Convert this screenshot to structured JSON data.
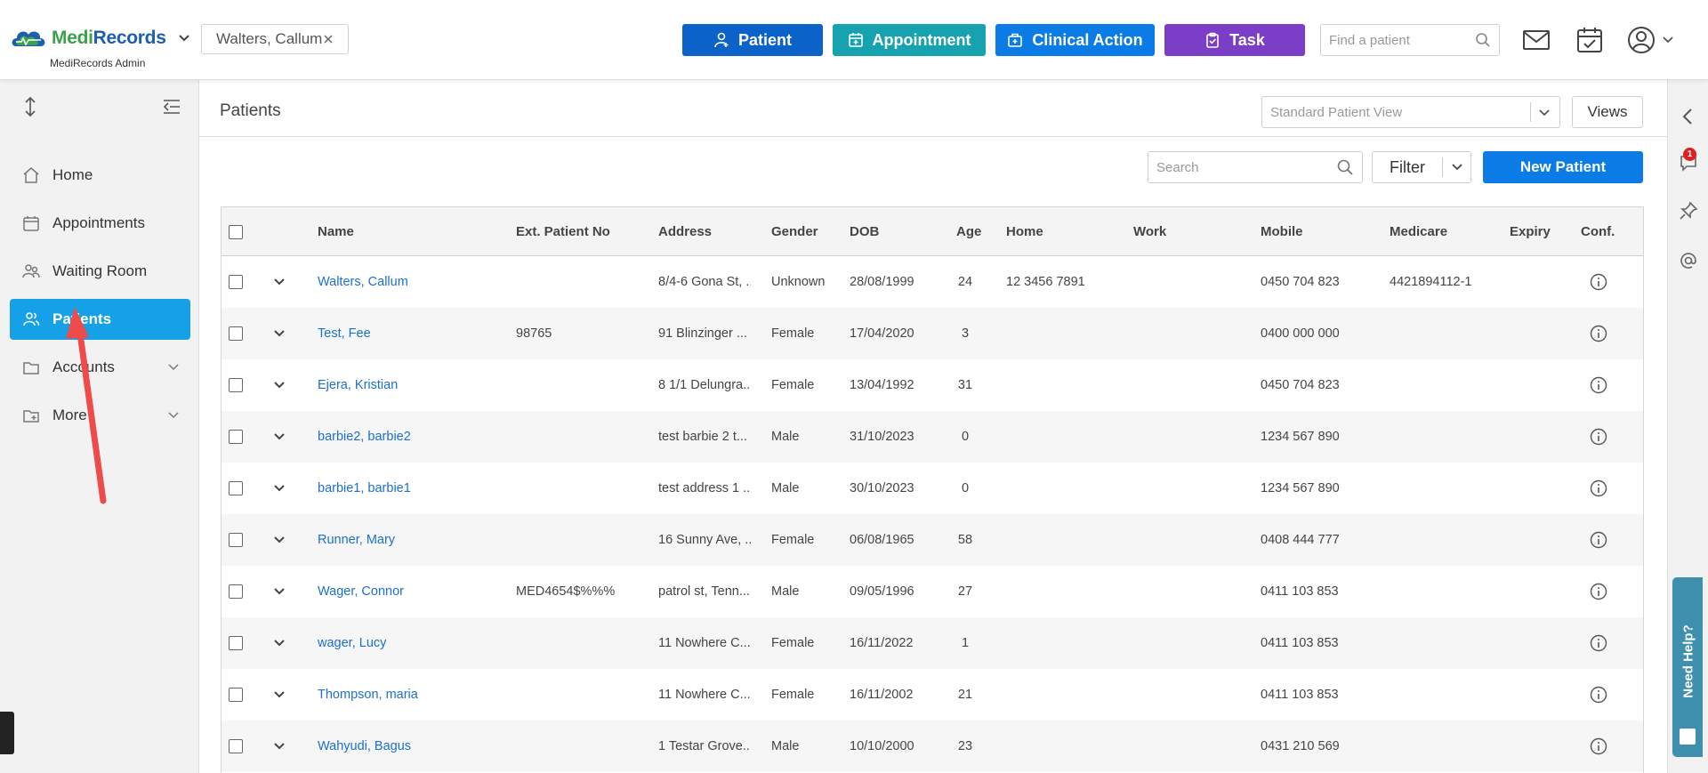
{
  "app": {
    "brand_part1": "Medi",
    "brand_part2": "Records",
    "brand_subtitle": "MediRecords Admin"
  },
  "open_patient_tab": "Walters, Callum",
  "actions": {
    "patient": "Patient",
    "appointment": "Appointment",
    "clinical_action": "Clinical Action",
    "task": "Task"
  },
  "find_patient_placeholder": "Find a patient",
  "sidebar": {
    "items": [
      {
        "label": "Home"
      },
      {
        "label": "Appointments"
      },
      {
        "label": "Waiting Room"
      },
      {
        "label": "Patients"
      },
      {
        "label": "Accounts"
      },
      {
        "label": "More"
      }
    ]
  },
  "page": {
    "title": "Patients",
    "view_select_value": "Standard Patient View",
    "views_label": "Views",
    "search_placeholder": "Search",
    "filter_label": "Filter",
    "new_patient_label": "New Patient"
  },
  "table": {
    "columns": {
      "name": "Name",
      "ext_no": "Ext. Patient No",
      "address": "Address",
      "gender": "Gender",
      "dob": "DOB",
      "age": "Age",
      "home": "Home",
      "work": "Work",
      "mobile": "Mobile",
      "medicare": "Medicare",
      "expiry": "Expiry",
      "conf": "Conf."
    },
    "rows": [
      {
        "name": "Walters, Callum",
        "ext_no": "",
        "address": "8/4-6 Gona St, ...",
        "gender": "Unknown",
        "dob": "28/08/1999",
        "age": "24",
        "home": "12 3456 7891",
        "work": "",
        "mobile": "0450 704 823",
        "medicare": "4421894112-1",
        "expiry": ""
      },
      {
        "name": "Test, Fee",
        "ext_no": "98765",
        "address": "91 Blinzinger ...",
        "gender": "Female",
        "dob": "17/04/2020",
        "age": "3",
        "home": "",
        "work": "",
        "mobile": "0400 000 000",
        "medicare": "",
        "expiry": ""
      },
      {
        "name": "Ejera, Kristian",
        "ext_no": "",
        "address": "8 1/1 Delungra...",
        "gender": "Female",
        "dob": "13/04/1992",
        "age": "31",
        "home": "",
        "work": "",
        "mobile": "0450 704 823",
        "medicare": "",
        "expiry": ""
      },
      {
        "name": "barbie2, barbie2",
        "ext_no": "",
        "address": "test barbie 2 t...",
        "gender": "Male",
        "dob": "31/10/2023",
        "age": "0",
        "home": "",
        "work": "",
        "mobile": "1234 567 890",
        "medicare": "",
        "expiry": ""
      },
      {
        "name": "barbie1, barbie1",
        "ext_no": "",
        "address": "test address 1 ...",
        "gender": "Male",
        "dob": "30/10/2023",
        "age": "0",
        "home": "",
        "work": "",
        "mobile": "1234 567 890",
        "medicare": "",
        "expiry": ""
      },
      {
        "name": "Runner, Mary",
        "ext_no": "",
        "address": "16 Sunny Ave, ...",
        "gender": "Female",
        "dob": "06/08/1965",
        "age": "58",
        "home": "",
        "work": "",
        "mobile": "0408 444 777",
        "medicare": "",
        "expiry": ""
      },
      {
        "name": "Wager, Connor",
        "ext_no": "MED4654$%%%",
        "address": "patrol st, Tenn...",
        "gender": "Male",
        "dob": "09/05/1996",
        "age": "27",
        "home": "",
        "work": "",
        "mobile": "0411 103 853",
        "medicare": "",
        "expiry": ""
      },
      {
        "name": "wager, Lucy",
        "ext_no": "",
        "address": "11 Nowhere C...",
        "gender": "Female",
        "dob": "16/11/2022",
        "age": "1",
        "home": "",
        "work": "",
        "mobile": "0411 103 853",
        "medicare": "",
        "expiry": ""
      },
      {
        "name": "Thompson, maria",
        "ext_no": "",
        "address": "11 Nowhere C...",
        "gender": "Female",
        "dob": "16/11/2002",
        "age": "21",
        "home": "",
        "work": "",
        "mobile": "0411 103 853",
        "medicare": "",
        "expiry": ""
      },
      {
        "name": "Wahyudi, Bagus",
        "ext_no": "",
        "address": "1 Testar Grove...",
        "gender": "Male",
        "dob": "10/10/2000",
        "age": "23",
        "home": "",
        "work": "",
        "mobile": "0431 210 569",
        "medicare": "",
        "expiry": ""
      }
    ]
  },
  "rail": {
    "notification_count": "1"
  },
  "help_label": "Need Help?",
  "colors": {
    "active_nav": "#15a0e8",
    "patient_btn": "#0b62c9",
    "appointment_btn": "#17a2b0",
    "clinical_btn": "#0b7ce6",
    "task_btn": "#7a3fc6",
    "link": "#1a6fd0",
    "annotation_arrow": "#ee4b4b"
  },
  "icons": {
    "topbar": [
      "logo-icon",
      "chevron-down-icon",
      "close-icon",
      "user-plus-icon",
      "calendar-plus-icon",
      "medical-bag-icon",
      "clipboard-check-icon",
      "search-icon",
      "mail-icon",
      "calendar-check-icon",
      "user-circle-icon"
    ],
    "sidebar": [
      "resize-vertical-icon",
      "collapse-menu-icon",
      "home-icon",
      "calendar-icon",
      "people-icon",
      "patients-icon",
      "folder-icon",
      "folder-plus-icon"
    ],
    "rail": [
      "chevron-left-icon",
      "chat-icon",
      "pin-icon",
      "at-icon"
    ]
  }
}
